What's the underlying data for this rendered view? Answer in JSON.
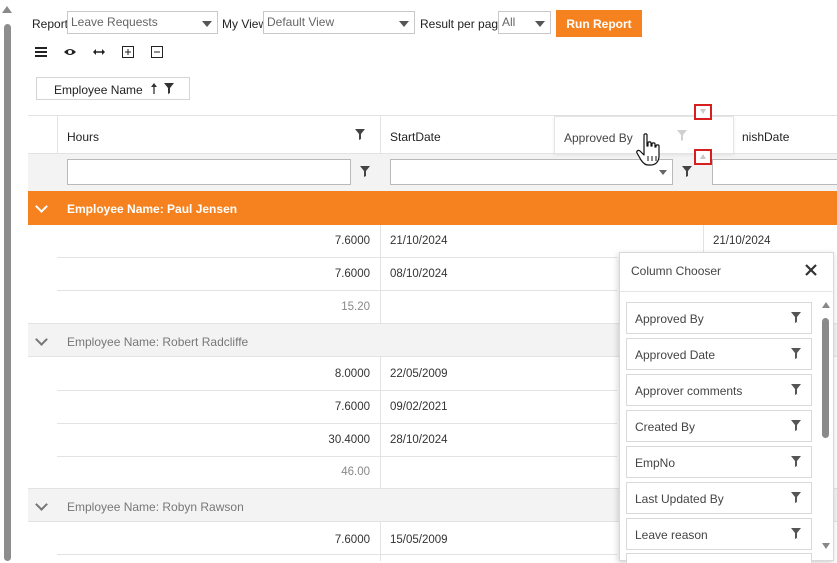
{
  "toolbar": {
    "report_label": "Report",
    "report_value": "Leave Requests",
    "myview_label": "My View",
    "myview_value": "Default View",
    "rpp_label": "Result per page",
    "rpp_value": "All",
    "run_label": "Run Report"
  },
  "group_panel": {
    "chip_label": "Employee Name"
  },
  "grid": {
    "columns": {
      "hours": "Hours",
      "start": "StartDate",
      "finish_partial": "nishDate"
    },
    "drag_ghost_label": "Approved By",
    "groups": [
      {
        "label": "Employee Name: Paul Jensen",
        "rows": [
          {
            "hours": "7.6000",
            "start": "21/10/2024",
            "finish": "21/10/2024"
          },
          {
            "hours": "7.6000",
            "start": "08/10/2024",
            "finish": ""
          }
        ],
        "summary": "15.20"
      },
      {
        "label": "Employee Name: Robert Radcliffe",
        "rows": [
          {
            "hours": "8.0000",
            "start": "22/05/2009"
          },
          {
            "hours": "7.6000",
            "start": "09/02/2021"
          },
          {
            "hours": "30.4000",
            "start": "28/10/2024"
          }
        ],
        "summary": "46.00"
      },
      {
        "label": "Employee Name: Robyn Rawson",
        "rows": [
          {
            "hours": "7.6000",
            "start": "15/05/2009"
          }
        ]
      }
    ]
  },
  "column_chooser": {
    "title": "Column Chooser",
    "items": [
      "Approved By",
      "Approved Date",
      "Approver comments",
      "Created By",
      "EmpNo",
      "Last Updated By",
      "Leave reason"
    ]
  },
  "colors": {
    "accent": "#f5821f",
    "highlight_border": "#d62020"
  }
}
